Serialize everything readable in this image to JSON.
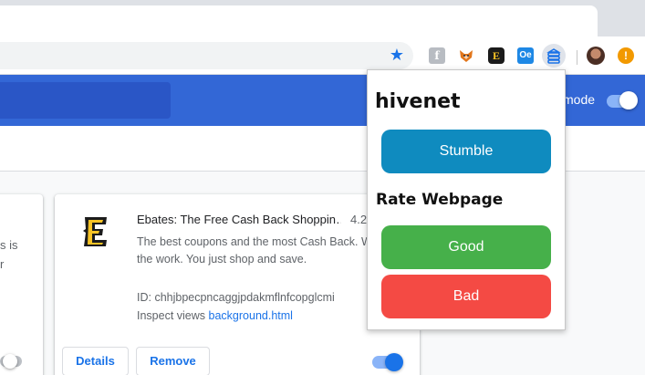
{
  "browser": {
    "extensions": [
      {
        "name": "f-extension-icon",
        "glyph": "f"
      },
      {
        "name": "fox-extension-icon",
        "glyph": "🦊"
      },
      {
        "name": "ebates-extension-icon",
        "glyph": "E"
      },
      {
        "name": "oe-extension-icon",
        "glyph": "Oe"
      },
      {
        "name": "hivenet-extension-icon",
        "glyph": "≋"
      }
    ],
    "alert_glyph": "!"
  },
  "page": {
    "devmode_label": "mode",
    "left_card_fragment": "s is\nr"
  },
  "extension_card": {
    "name": "Ebates: The Free Cash Back Shoppin…",
    "version": "4.2",
    "description": "The best coupons and the most Cash Back. We do all the work. You just shop and save.",
    "id_label": "ID: chhjbpecpncaggjpdakmflnfcopglcmi",
    "inspect_label": "Inspect views",
    "inspect_link": "background.html",
    "details_button": "Details",
    "remove_button": "Remove",
    "enabled": true
  },
  "popup": {
    "title": "hivenet",
    "stumble_button": "Stumble",
    "rate_heading": "Rate Webpage",
    "good_button": "Good",
    "bad_button": "Bad"
  },
  "colors": {
    "stumble": "#0f8bbf",
    "good": "#46b04a",
    "bad": "#f44a44",
    "brand_blue": "#3367d6",
    "link_blue": "#1a73e8"
  }
}
